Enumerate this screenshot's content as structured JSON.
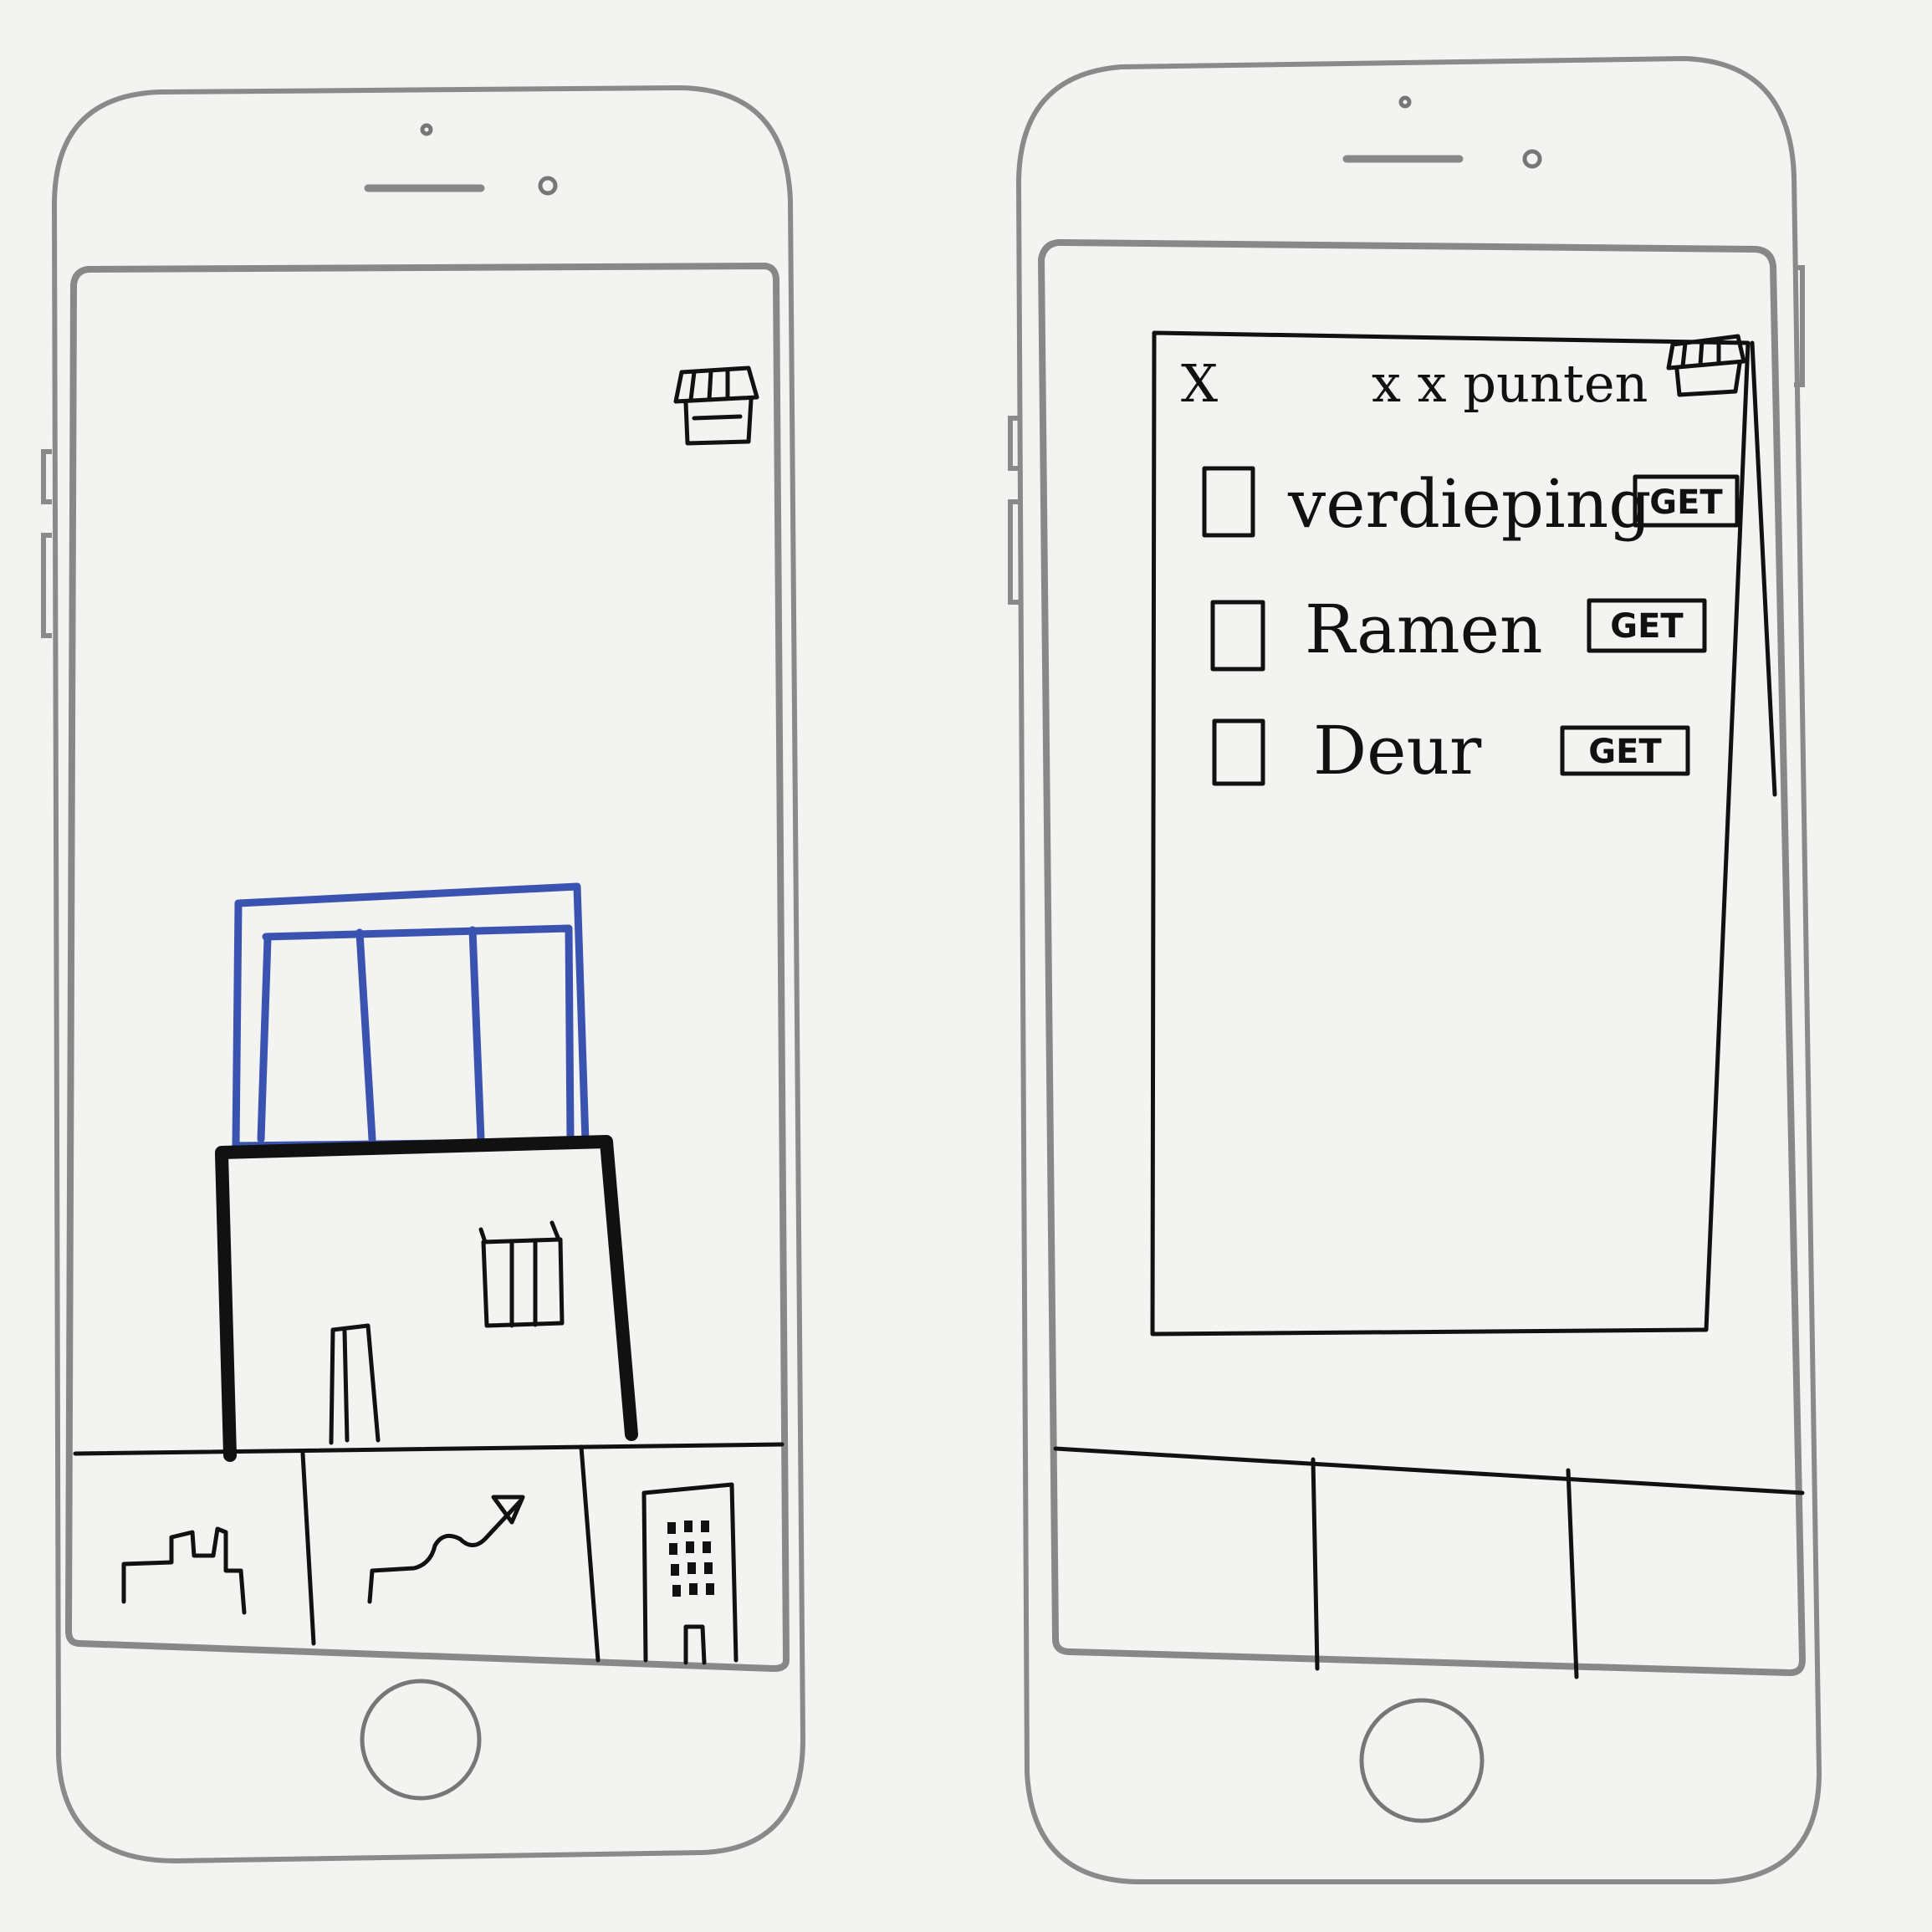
{
  "store_icon": "store-awning-icon",
  "tab_bar_icons": [
    "skyline-icon",
    "trend-arrow-icon",
    "building-icon"
  ],
  "shop_panel": {
    "close_label": "X",
    "points_label": "x x punten",
    "items": [
      {
        "label": "verdieping",
        "button": "GET"
      },
      {
        "label": "Ramen",
        "button": "GET"
      },
      {
        "label": "Deur",
        "button": "GET"
      }
    ]
  },
  "colors": {
    "pen": "#111111",
    "highlight": "#3a53b0"
  }
}
